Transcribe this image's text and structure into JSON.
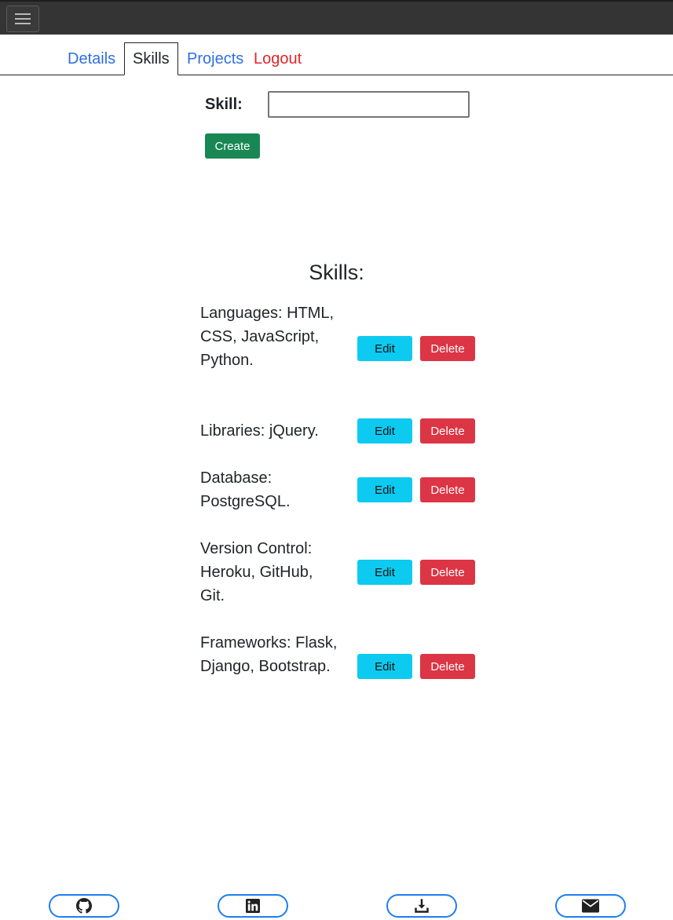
{
  "tabs": [
    {
      "label": "Details"
    },
    {
      "label": "Skills"
    },
    {
      "label": "Projects"
    },
    {
      "label": "Logout"
    }
  ],
  "form": {
    "skill_label": "Skill:",
    "skill_value": "",
    "create_label": "Create"
  },
  "skills_title": "Skills:",
  "skills": [
    {
      "text": "Languages: HTML, CSS, JavaScript, Python.",
      "edit": "Edit",
      "delete": "Delete"
    },
    {
      "text": "Libraries: jQuery.",
      "edit": "Edit",
      "delete": "Delete"
    },
    {
      "text": "Database: PostgreSQL.",
      "edit": "Edit",
      "delete": "Delete"
    },
    {
      "text": "Version Control: Heroku, GitHub, Git.",
      "edit": "Edit",
      "delete": "Delete"
    },
    {
      "text": "Frameworks: Flask, Django, Bootstrap.",
      "edit": "Edit",
      "delete": "Delete"
    }
  ],
  "footer": [
    {
      "icon": "github-icon"
    },
    {
      "icon": "linkedin-icon"
    },
    {
      "icon": "download-icon"
    },
    {
      "icon": "envelope-icon"
    }
  ],
  "colors": {
    "navbar": "#343434",
    "link": "#2f6fe0",
    "logout": "#e3252a",
    "create": "#198754",
    "edit": "#0dcaf0",
    "delete": "#dc3545",
    "footer_border": "#1c7ef0"
  }
}
